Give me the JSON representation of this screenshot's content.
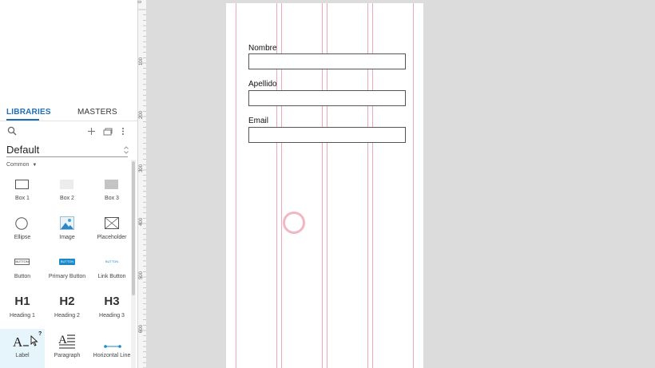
{
  "libraries_panel": {
    "tabs": [
      {
        "label": "LIBRARIES",
        "active": true
      },
      {
        "label": "MASTERS",
        "active": false
      }
    ],
    "library_select": "Default",
    "section": "Common",
    "widgets": [
      {
        "label": "Box 1",
        "icon": "box-1-icon"
      },
      {
        "label": "Box 2",
        "icon": "box-2-icon"
      },
      {
        "label": "Box 3",
        "icon": "box-3-icon"
      },
      {
        "label": "Ellipse",
        "icon": "ellipse-icon"
      },
      {
        "label": "Image",
        "icon": "image-icon"
      },
      {
        "label": "Placeholder",
        "icon": "placeholder-icon"
      },
      {
        "label": "Button",
        "icon": "button-icon"
      },
      {
        "label": "Primary Button",
        "icon": "primary-button-icon"
      },
      {
        "label": "Link Button",
        "icon": "link-button-icon"
      },
      {
        "label": "Heading 1",
        "icon": "heading-1-icon"
      },
      {
        "label": "Heading 2",
        "icon": "heading-2-icon"
      },
      {
        "label": "Heading 3",
        "icon": "heading-3-icon"
      },
      {
        "label": "Label",
        "icon": "label-icon"
      },
      {
        "label": "Paragraph",
        "icon": "paragraph-icon"
      },
      {
        "label": "Horizontal Line",
        "icon": "horizontal-line-icon"
      }
    ],
    "icon_text": {
      "button": "BUTTON",
      "h1": "H1",
      "h2": "H2",
      "h3": "H3",
      "help": "?"
    }
  },
  "ruler": {
    "ticks": [
      "0",
      "100",
      "200",
      "300",
      "400",
      "500",
      "600"
    ]
  },
  "canvas": {
    "form": {
      "fields": [
        {
          "label": "Nombre",
          "value": ""
        },
        {
          "label": "Apellido",
          "value": ""
        },
        {
          "label": "Email",
          "value": ""
        }
      ]
    }
  },
  "colors": {
    "accent": "#1e6fb8",
    "primary_button": "#1a8ac9",
    "gridline": "#f0a8b5",
    "canvas_background": "#dcdcdc"
  }
}
